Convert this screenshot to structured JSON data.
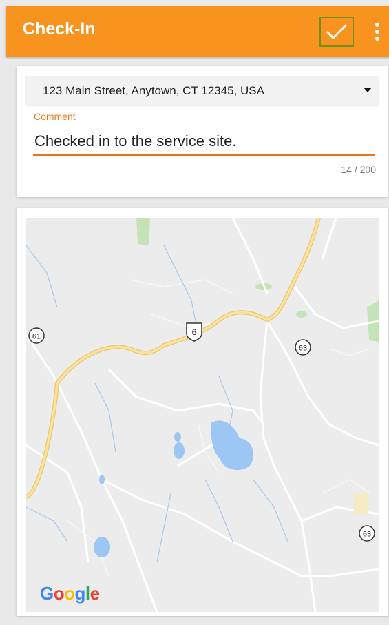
{
  "app_bar": {
    "title": "Check-In",
    "confirm_icon": "check-icon",
    "overflow_icon": "more-vert-icon",
    "color": "#f7931e"
  },
  "form": {
    "address_selected": "123 Main Street, Anytown, CT 12345, USA",
    "comment_label": "Comment",
    "comment_value": "Checked in to the service site.",
    "char_counter": "14 / 200",
    "accent_color": "#e8741a"
  },
  "map": {
    "route_shields": [
      "61",
      "6",
      "63",
      "63"
    ],
    "attribution": "Google"
  }
}
